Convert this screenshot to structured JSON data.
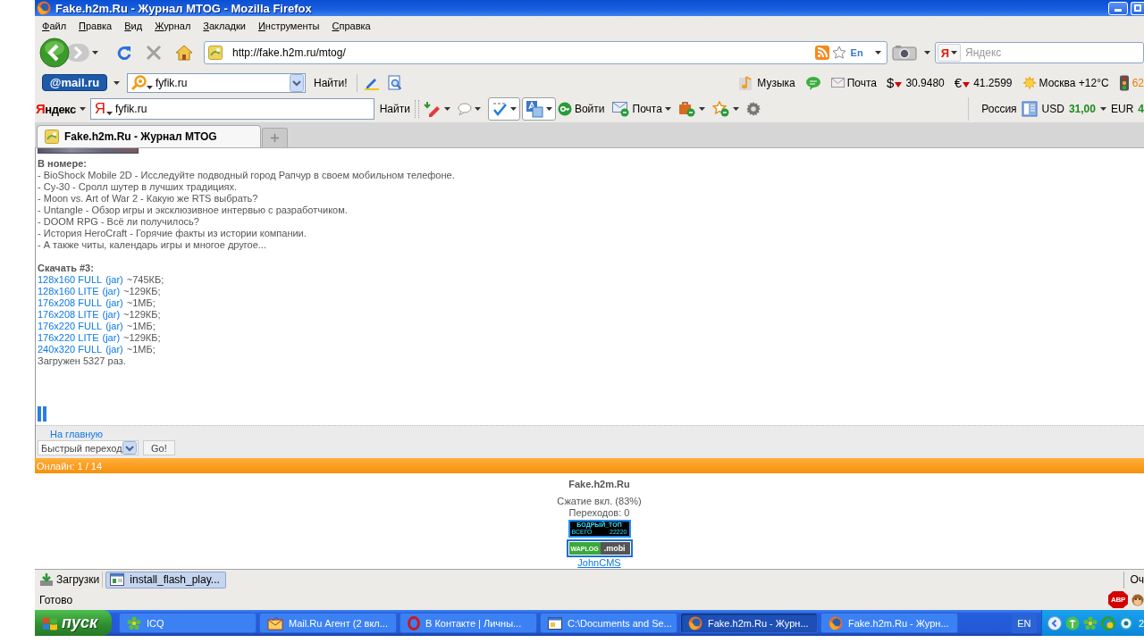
{
  "window": {
    "title": "Fake.h2m.Ru - Журнал MTOG - Mozilla Firefox"
  },
  "menu": [
    "Файл",
    "Правка",
    "Вид",
    "Журнал",
    "Закладки",
    "Инструменты",
    "Справка"
  ],
  "nav_bar": {
    "url": "http://fake.h2m.ru/mtog/",
    "layout_indicator": "En",
    "search_engine_letter": "Я",
    "search_placeholder": "Яндекс"
  },
  "mail_toolbar": {
    "logo": "@mail.ru",
    "search_value": "fyfik.ru",
    "search_button": "Найти!",
    "informers": [
      {
        "kind": "music",
        "label": "Музыка"
      },
      {
        "kind": "chat"
      },
      {
        "kind": "mail",
        "label": "Почта"
      },
      {
        "kind": "currency",
        "symbol": "$",
        "falling": true,
        "value": "30.9480"
      },
      {
        "kind": "currency",
        "symbol": "€",
        "falling": true,
        "value": "41.2599"
      },
      {
        "kind": "weather",
        "label": "Москва +12°C"
      },
      {
        "kind": "traffic",
        "label": "62"
      }
    ]
  },
  "yandex_toolbar": {
    "logo": "Яндекс",
    "engine_letter": "Я",
    "search_value": "fyfik.ru",
    "search_button": "Найти",
    "tools": [
      {
        "kind": "marker"
      },
      {
        "kind": "comment"
      },
      {
        "kind": "spellcheck"
      },
      {
        "kind": "translate"
      },
      {
        "kind": "login",
        "label": "Войти"
      },
      {
        "kind": "mail",
        "label": "Почта"
      },
      {
        "kind": "bag"
      },
      {
        "kind": "favorites"
      },
      {
        "kind": "settings"
      }
    ],
    "region": "Россия",
    "rates": [
      {
        "currency": "USD",
        "value": "31,00",
        "menu": true
      },
      {
        "currency": "EUR",
        "value": "4",
        "menu": false
      }
    ]
  },
  "tabs": [
    {
      "label": "Fake.h2m.Ru - Журнал MTOG",
      "selected": true
    }
  ],
  "page": {
    "issue_heading": "В номере:",
    "issue_items": [
      "- BioShock Mobile 2D - Исследуйте подводный город Рапчур в своем мобильном телефоне.",
      "- Су-30 - Сролл шутер в лучших традициях.",
      "- Moon vs. Art of War 2 - Какую же RTS выбрать?",
      "- Untangle - Обзор игры и эксклюзивное интервью с разработчиком.",
      "- DOOM RPG - Всё ли получилось?",
      "- История HeroCraft - Горячие факты из истории компании.",
      "- А также читы, календарь игры и многое другое..."
    ],
    "download_heading": "Скачать #3:",
    "downloads": [
      {
        "model": "128x160 FULL",
        "format": "(jar)",
        "size": "~745КБ;"
      },
      {
        "model": "128x160 LITE",
        "format": "(jar)",
        "size": "~129КБ;"
      },
      {
        "model": "176x208 FULL",
        "format": "(jar)",
        "size": "~1МБ;"
      },
      {
        "model": "176x208 LITE",
        "format": "(jar)",
        "size": "~129КБ;"
      },
      {
        "model": "176x220 FULL",
        "format": "(jar)",
        "size": "~1МБ;"
      },
      {
        "model": "176x220 LITE",
        "format": "(jar)",
        "size": "~129КБ;"
      },
      {
        "model": "240x320 FULL",
        "format": "(jar)",
        "size": "~1МБ;"
      }
    ],
    "download_count": "Загружен 5327 раз.",
    "home_link": "На главную",
    "quick_nav": {
      "value": "Быстрый переход",
      "button": "Go!"
    }
  },
  "online_bar": {
    "text": "Онлайн: 1 / 14"
  },
  "footer": {
    "site_name": "Fake.h2m.Ru",
    "compression": "Сжатие вкл. (83%)",
    "visits": "Переходов: 0",
    "counter_banner": {
      "title": "БОДРЫЙ_ТОП",
      "label": "ВСЕГО",
      "value": "22220"
    },
    "rating_banner": {
      "left": "WAPLOG",
      "right": ".mobi"
    },
    "engine_link": "JohnCMS"
  },
  "download_bar": {
    "label": "Загрузки",
    "items": [
      {
        "label": "install_flash_play..."
      }
    ],
    "clear_button": "Оч"
  },
  "status_bar": {
    "text": "Готово",
    "adblock_label": "ABP"
  },
  "taskbar": {
    "start": "пуск",
    "tasks": [
      {
        "kind": "icq",
        "label": "ICQ",
        "selected": false
      },
      {
        "kind": "agent",
        "label": "Mail.Ru Агент (2 вкл...",
        "selected": false
      },
      {
        "kind": "opera",
        "label": "В Контакте | Личны...",
        "selected": false
      },
      {
        "kind": "explorer",
        "label": "C:\\Documents and Se...",
        "selected": false
      },
      {
        "kind": "firefox",
        "label": "Fake.h2m.Ru - Журн...",
        "selected": true
      },
      {
        "kind": "firefox",
        "label": "Fake.h2m.Ru - Журн...",
        "selected": false
      }
    ],
    "language": "EN",
    "clock": "2"
  }
}
